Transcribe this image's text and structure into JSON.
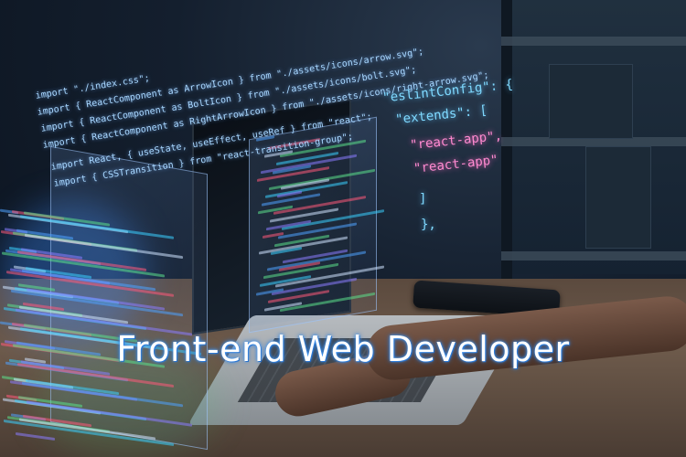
{
  "image": {
    "headline": "Front-end Web Developer",
    "code_imports": [
      "import \"./index.css\";",
      "import { ReactComponent as ArrowIcon } from \"./assets/icons/arrow.svg\";",
      "import { ReactComponent as BoltIcon } from \"./assets/icons/bolt.svg\";",
      "import { ReactComponent as RightArrowIcon } from \"./assets/icons/right-arrow.svg\";",
      "import React, { useState, useEffect, useRef } from \"react\";",
      "import { CSSTransition } from \"react-transition-group\";"
    ],
    "eslint_config": [
      "\"eslintConfig\": {",
      "\"extends\": [",
      "\"react-app\",",
      "\"react-app\"",
      "]",
      "},"
    ],
    "colors": {
      "headline_glow": "#4aa3ff",
      "code_blue": "#a8d7ff",
      "json_cyan": "#7fd9ff",
      "json_pink": "#ff8ad0",
      "background": "#0b1422"
    }
  }
}
